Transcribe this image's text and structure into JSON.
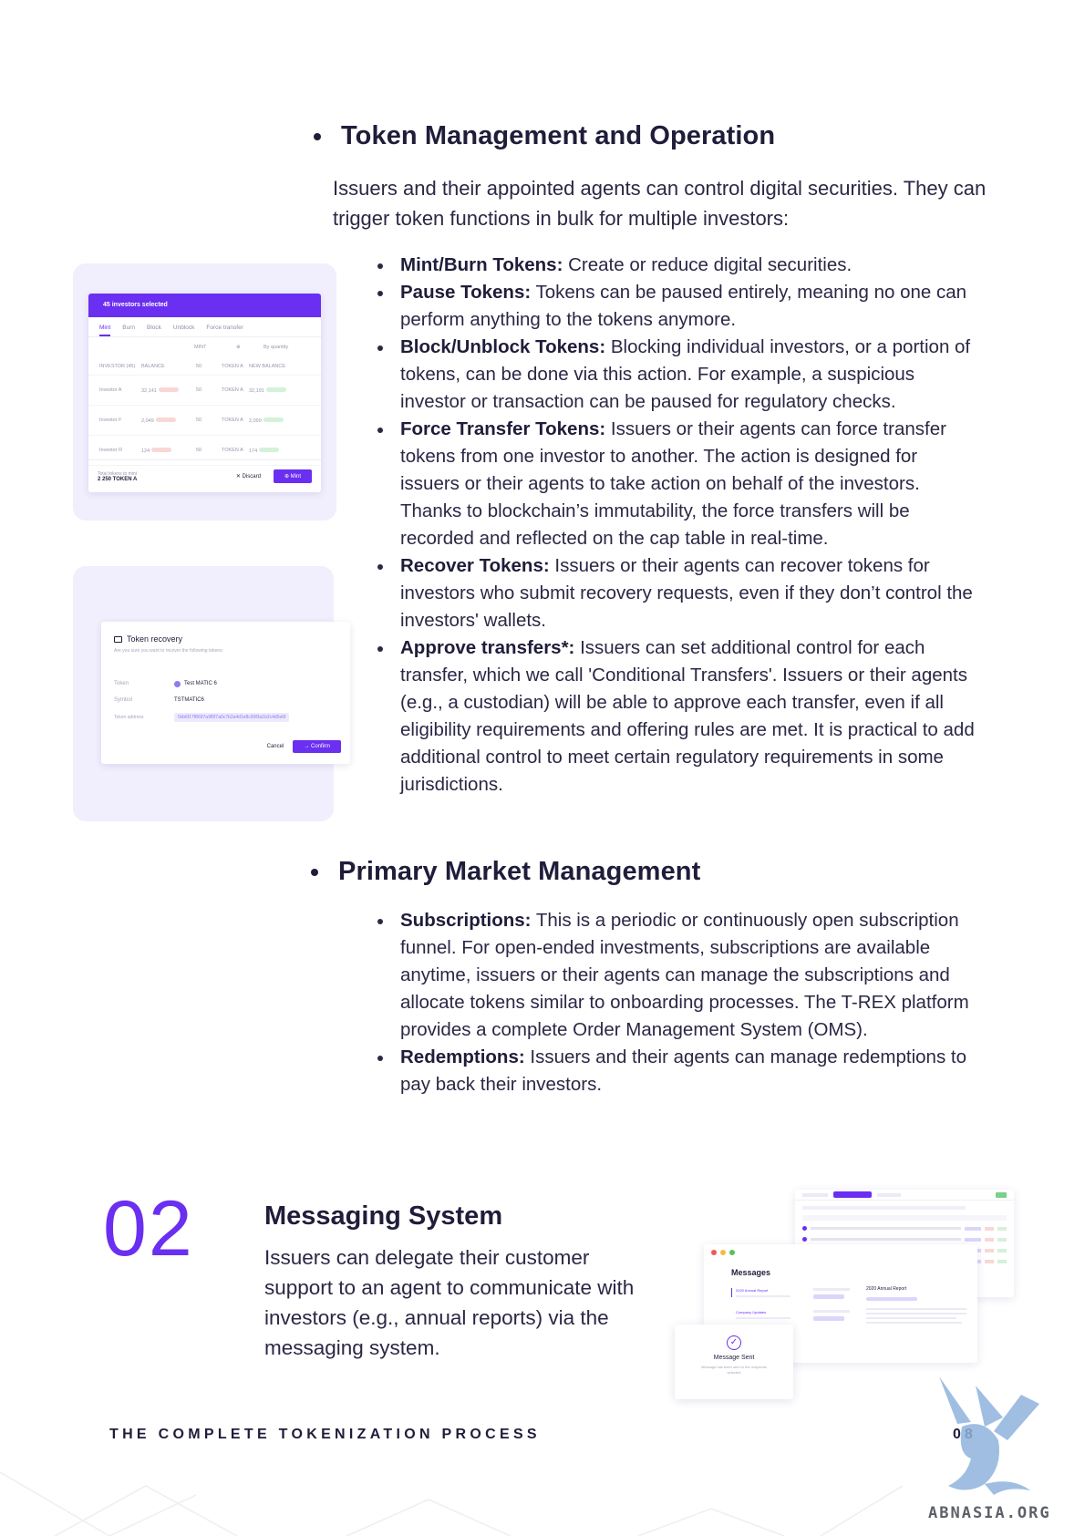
{
  "token_section": {
    "heading": "Token Management and Operation",
    "intro": "Issuers and their appointed agents can control digital securities. They can trigger token functions in bulk for multiple investors:",
    "items": [
      {
        "label": "Mint/Burn Tokens:",
        "text": " Create or reduce digital securities."
      },
      {
        "label": "Pause Tokens:",
        "text": " Tokens can be paused entirely, meaning no one can perform anything to the tokens anymore."
      },
      {
        "label": "Block/Unblock Tokens:",
        "text": " Blocking individual investors, or a portion of tokens, can be done via this action. For example, a suspicious investor or transaction can be paused for regulatory checks."
      },
      {
        "label": "Force Transfer Tokens:",
        "text": " Issuers or their agents can force transfer tokens from one investor to another. The action is designed for issuers or their agents to take action on behalf of the investors. Thanks to blockchain’s immutability, the force transfers will be recorded and reflected on the cap table in real-time."
      },
      {
        "label": "Recover Tokens:",
        "text": " Issuers or their agents can recover tokens for investors who submit recovery requests, even if they don’t control the investors' wallets."
      },
      {
        "label": "Approve transfers*:",
        "text": " Issuers can set additional control for each transfer, which we call 'Conditional Transfers'. Issuers or their agents (e.g., a custodian) will be able to approve each transfer, even if all eligibility requirements and offering rules are met. It is practical to add additional control to meet certain regulatory requirements in some jurisdictions."
      }
    ]
  },
  "market_section": {
    "heading": "Primary Market Management",
    "items": [
      {
        "label": "Subscriptions:",
        "text": " This is a periodic or continuously open subscription funnel. For open-ended investments, subscriptions are available anytime, issuers or their agents can manage the subscriptions and allocate tokens similar to onboarding processes. The T-REX platform provides a complete Order Management System (OMS)."
      },
      {
        "label": "Redemptions:",
        "text": " Issuers and their agents can manage redemptions to pay back their investors."
      }
    ]
  },
  "mint_mockup": {
    "header": "45 investors selected",
    "tabs": [
      "Mint",
      "Burn",
      "Block",
      "Unblock",
      "Force transfer"
    ],
    "column_mint": "MINT",
    "quantity_select": "By quantity",
    "columns": [
      "INVESTOR (45)",
      "BALANCE",
      "50",
      "TOKEN A",
      "NEW BALANCE"
    ],
    "rows": [
      {
        "investor": "Investor A",
        "balance": "32,141",
        "mint": "50",
        "token": "TOKEN A",
        "new_balance": "32,191"
      },
      {
        "investor": "Investor F",
        "balance": "2,049",
        "mint": "50",
        "token": "TOKEN A",
        "new_balance": "2,099"
      },
      {
        "investor": "Investor R",
        "balance": "124",
        "mint": "50",
        "token": "TOKEN A",
        "new_balance": "174"
      }
    ],
    "total_label": "Total tokens to mint",
    "total_value": "2 250 TOKEN A",
    "discard": "Discard",
    "mint_button": "Mint"
  },
  "recovery_mockup": {
    "title": "Token recovery",
    "subtitle": "Are you sure you want to recover the following tokens:",
    "token_label": "Token",
    "token_value": "Test MATIC 6",
    "symbol_label": "Symbol",
    "symbol_value": "TSTMATIC6",
    "address_label": "Token address",
    "address_value": "0xb6f17f8697a9f5f7a0c7b2a4d1e8c90f3a1b2c4d5e6f",
    "cancel": "Cancel",
    "confirm": "Confirm"
  },
  "messaging_section": {
    "number": "02",
    "title": "Messaging System",
    "text": "Issuers can delegate their customer support to an agent to communicate with investors (e.g., annual reports) via the messaging system."
  },
  "messages_mockup": {
    "panel_title": "Messages",
    "item1": "2020 Annual Report",
    "item2": "Company Updates",
    "detail_title": "2020 Annual Report",
    "sent_title": "Message Sent",
    "sent_sub": "Message has been sent to the recipients selected"
  },
  "footer": {
    "title": "THE COMPLETE TOKENIZATION PROCESS",
    "page": "08",
    "watermark": "ABNASIA.ORG"
  },
  "colors": {
    "accent": "#6a2ff0",
    "text": "#1f1d3a",
    "mock_bg": "#f1eefd"
  }
}
